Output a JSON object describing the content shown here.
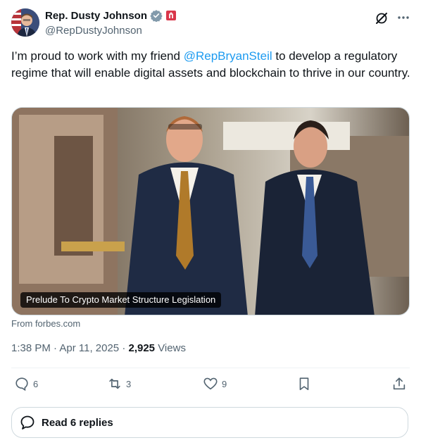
{
  "author": {
    "name": "Rep. Dusty Johnson",
    "handle": "@RepDustyJohnson"
  },
  "tweet": {
    "text_before": "I’m proud to work with my friend ",
    "mention": "@RepBryanSteil",
    "text_after": "  to develop a regulatory regime that will enable digital assets and blockchain to thrive in our country."
  },
  "card": {
    "title": "Prelude To Crypto Market Structure Legislation",
    "source": "From forbes.com"
  },
  "meta": {
    "time": "1:38 PM · Apr 11, 2025 · ",
    "views_count": "2,925",
    "views_label": " Views"
  },
  "actions": {
    "replies": "6",
    "reposts": "3",
    "likes": "9"
  },
  "read_replies": "Read 6 replies",
  "colors": {
    "accent": "#1d9bf0",
    "muted": "#536471",
    "text": "#0f1419"
  },
  "icons": [
    "verified-badge-icon",
    "government-affiliation-icon",
    "grok-icon",
    "more-icon",
    "reply-icon",
    "repost-icon",
    "like-icon",
    "bookmark-icon",
    "share-icon",
    "chat-bubble-icon"
  ]
}
